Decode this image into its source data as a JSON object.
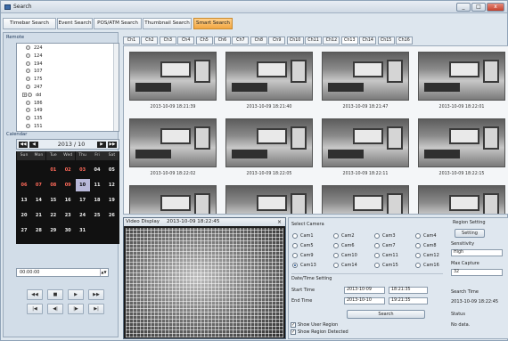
{
  "window": {
    "title": "Search",
    "min": "_",
    "max": "□",
    "close": "x"
  },
  "tabs": [
    "Timebar Search",
    "Event Search",
    "POS/ATM Search",
    "Thumbnail Search",
    "Smart Search"
  ],
  "active_tab": 4,
  "left": {
    "remote_label": "Remote",
    "cameras": [
      "224",
      "124",
      "194",
      "107",
      "175",
      "247",
      "dd",
      "186",
      "149",
      "135",
      "151"
    ],
    "selected_camera": "dd",
    "calendar_label": "Calendar",
    "month": "2013 / 10",
    "nav": {
      "prev_year": "◀◀",
      "prev_month": "◀",
      "next_month": "▶",
      "next_year": "▶▶"
    },
    "dow": [
      "Sun",
      "Mon",
      "Tue",
      "Wed",
      "Thu",
      "Fri",
      "Sat"
    ],
    "weeks": [
      [
        "",
        "",
        "01",
        "02",
        "03",
        "04",
        "05"
      ],
      [
        "06",
        "07",
        "08",
        "09",
        "10",
        "11",
        "12"
      ],
      [
        "13",
        "14",
        "15",
        "16",
        "17",
        "18",
        "19"
      ],
      [
        "20",
        "21",
        "22",
        "23",
        "24",
        "25",
        "26"
      ],
      [
        "27",
        "28",
        "29",
        "30",
        "31",
        "",
        ""
      ]
    ],
    "record_days": [
      "01",
      "02",
      "03",
      "06",
      "07",
      "08",
      "09"
    ],
    "selected_day": "10",
    "time": "00:00:00",
    "playback": [
      "◀◀",
      "■",
      "▶",
      "▶▶",
      "|◀",
      "◀|",
      "|▶",
      "▶|"
    ]
  },
  "channels": [
    "Ch1",
    "Ch2",
    "Ch3",
    "Ch4",
    "Ch5",
    "Ch6",
    "Ch7",
    "Ch8",
    "Ch9",
    "Ch10",
    "Ch11",
    "Ch12",
    "Ch13",
    "Ch14",
    "Ch15",
    "Ch16"
  ],
  "active_channel": 12,
  "thumbnails": [
    [
      "2013-10-09 18:21:39",
      "2013-10-09 18:21:40",
      "2013-10-09 18:21:47",
      "2013-10-09 18:22:01"
    ],
    [
      "2013-10-09 18:22:02",
      "2013-10-09 18:22:05",
      "2013-10-09 18:22:11",
      "2013-10-09 18:22:15"
    ],
    [
      "",
      "",
      "",
      ""
    ]
  ],
  "video": {
    "title": "Video Display",
    "timestamp": "2013-10-09 18:22:45",
    "close": "×"
  },
  "panel": {
    "select_camera": "Select Camera",
    "cams": [
      "Cam1",
      "Cam2",
      "Cam3",
      "Cam4",
      "Cam5",
      "Cam6",
      "Cam7",
      "Cam8",
      "Cam9",
      "Cam10",
      "Cam11",
      "Cam12",
      "Cam13",
      "Cam14",
      "Cam15",
      "Cam16"
    ],
    "selected_cam": "Cam13",
    "datetime_label": "Date/Time Setting",
    "start_label": "Start Time",
    "start_date": "2013-10-09",
    "start_time": "18:21:35",
    "end_label": "End Time",
    "end_date": "2013-10-10",
    "end_time": "19:21:35",
    "search": "Search",
    "show_user_region": "Show User Region",
    "show_region_detected": "Show Region Detected",
    "region_setting": "Region Setting",
    "setting_btn": "Setting",
    "sensitivity_label": "Sensitivity",
    "sensitivity": "High",
    "max_capture_label": "Max Capture",
    "max_capture": "32",
    "search_time_label": "Search Time",
    "search_time": "2013-10-09 18:22:45",
    "status_label": "Status",
    "status": "No data."
  }
}
